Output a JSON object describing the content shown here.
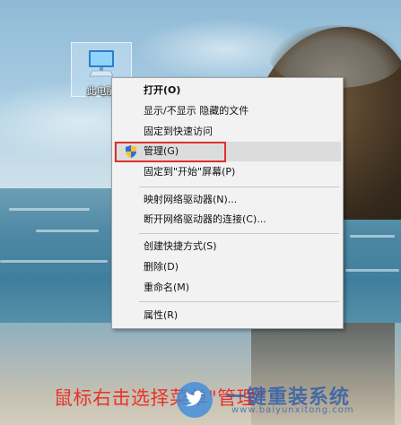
{
  "desktop": {
    "icon_label": "此电脑"
  },
  "context_menu": {
    "items": [
      {
        "label": "打开(O)",
        "bold": true
      },
      {
        "label": "显示/不显示 隐藏的文件"
      },
      {
        "label": "固定到快速访问"
      },
      {
        "label": "管理(G)",
        "icon": "uac-shield-icon",
        "hovered": true,
        "highlighted": true
      },
      {
        "label": "固定到\"开始\"屏幕(P)"
      },
      {
        "label": "映射网络驱动器(N)..."
      },
      {
        "label": "断开网络驱动器的连接(C)..."
      },
      {
        "label": "创建快捷方式(S)"
      },
      {
        "label": "删除(D)"
      },
      {
        "label": "重命名(M)"
      },
      {
        "label": "属性(R)"
      }
    ]
  },
  "caption": "鼠标右击选择菜单\"管理\"",
  "watermark": {
    "text": "一键重装系统",
    "url": "www.baiyunxitong.com",
    "logo_icon": "twitter-bird-icon"
  },
  "colors": {
    "highlight_border": "#e0302b",
    "caption": "#e8322a",
    "menu_bg": "#f2f2f2",
    "menu_hover": "#dcdcdc"
  }
}
